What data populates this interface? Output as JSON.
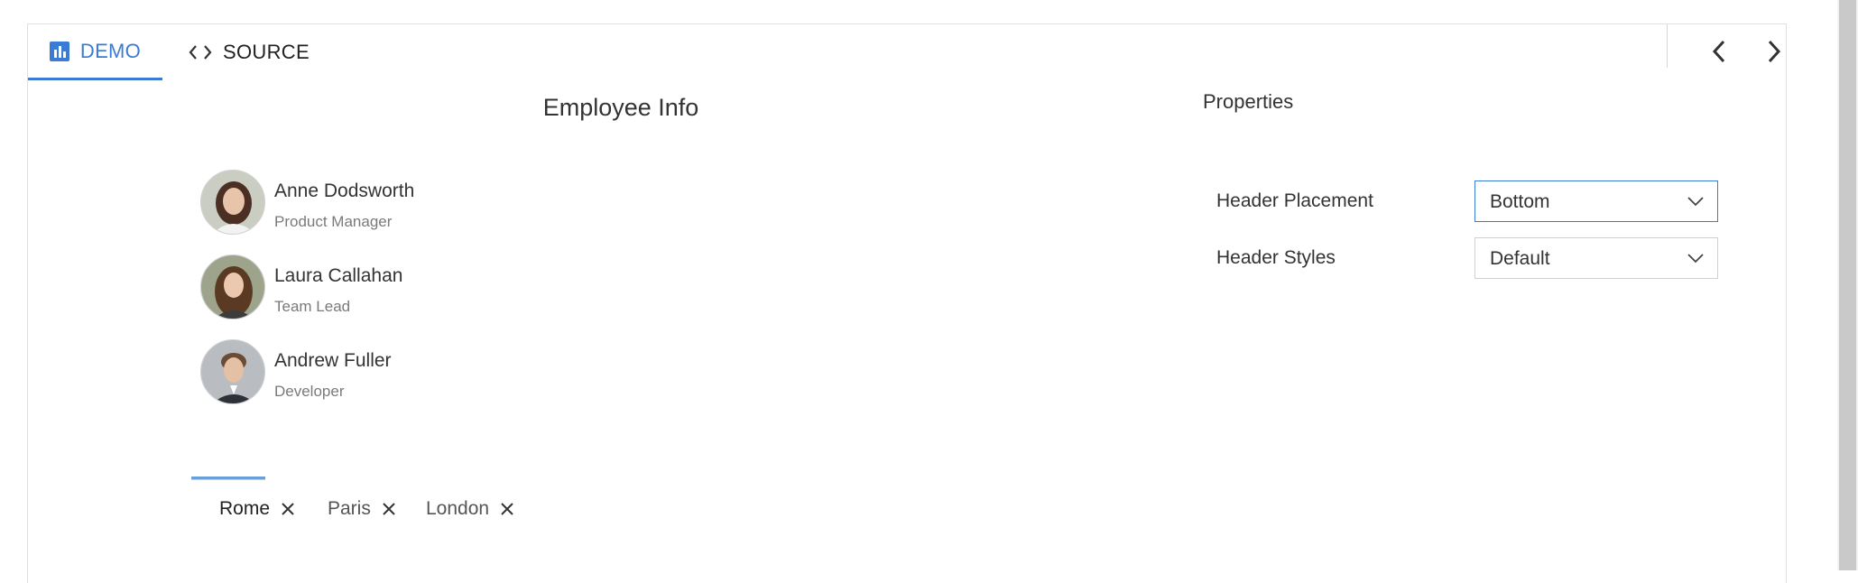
{
  "tabs": {
    "demo_label": "DEMO",
    "source_label": "SOURCE"
  },
  "panel": {
    "title": "Employee Info",
    "employees": [
      {
        "name": "Anne Dodsworth",
        "role": "Product Manager"
      },
      {
        "name": "Laura Callahan",
        "role": "Team Lead"
      },
      {
        "name": "Andrew Fuller",
        "role": "Developer"
      }
    ]
  },
  "header_tabs": {
    "items": [
      {
        "label": "Rome",
        "selected": true
      },
      {
        "label": "Paris",
        "selected": false
      },
      {
        "label": "London",
        "selected": false
      }
    ]
  },
  "properties": {
    "title": "Properties",
    "header_placement": {
      "label": "Header Placement",
      "value": "Bottom"
    },
    "header_styles": {
      "label": "Header Styles",
      "value": "Default"
    }
  },
  "colors": {
    "accent": "#3a7bd5",
    "text": "#212121",
    "muted": "#7a7a7a"
  }
}
